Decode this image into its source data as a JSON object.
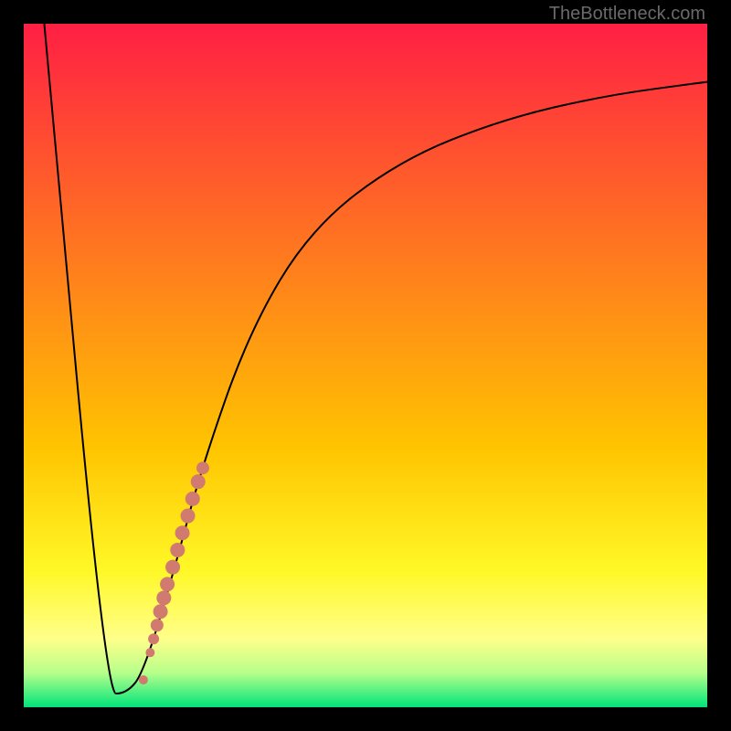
{
  "attribution": "TheBottleneck.com",
  "chart_data": {
    "type": "line",
    "title": "",
    "xlabel": "",
    "ylabel": "",
    "xlim": [
      0,
      100
    ],
    "ylim": [
      0,
      100
    ],
    "background_gradient": {
      "stops": [
        {
          "pos": 0.0,
          "color": "#ff1f44"
        },
        {
          "pos": 0.62,
          "color": "#ffc400"
        },
        {
          "pos": 0.8,
          "color": "#fff827"
        },
        {
          "pos": 0.9,
          "color": "#ffff8a"
        },
        {
          "pos": 0.95,
          "color": "#b5ff8a"
        },
        {
          "pos": 1.0,
          "color": "#00e47a"
        }
      ]
    },
    "series": [
      {
        "name": "bottleneck-curve",
        "type": "line",
        "color": "#000000",
        "points": [
          {
            "x": 3.0,
            "y": 100.0
          },
          {
            "x": 12.0,
            "y": 2.0
          },
          {
            "x": 15.0,
            "y": 2.0
          },
          {
            "x": 17.5,
            "y": 5.0
          },
          {
            "x": 22.0,
            "y": 20.0
          },
          {
            "x": 26.0,
            "y": 35.0
          },
          {
            "x": 33.0,
            "y": 55.0
          },
          {
            "x": 42.0,
            "y": 70.0
          },
          {
            "x": 55.0,
            "y": 80.0
          },
          {
            "x": 70.0,
            "y": 86.0
          },
          {
            "x": 85.0,
            "y": 89.5
          },
          {
            "x": 100.0,
            "y": 91.5
          }
        ]
      },
      {
        "name": "data-points-highlight",
        "type": "scatter",
        "color": "#d17a6f",
        "points": [
          {
            "x": 17.5,
            "y": 4.0,
            "r": 5
          },
          {
            "x": 18.5,
            "y": 8.0,
            "r": 5
          },
          {
            "x": 19.0,
            "y": 10.0,
            "r": 6
          },
          {
            "x": 19.5,
            "y": 12.0,
            "r": 7
          },
          {
            "x": 20.0,
            "y": 14.0,
            "r": 8
          },
          {
            "x": 20.5,
            "y": 16.0,
            "r": 8
          },
          {
            "x": 21.0,
            "y": 18.0,
            "r": 8
          },
          {
            "x": 21.8,
            "y": 20.5,
            "r": 8
          },
          {
            "x": 22.5,
            "y": 23.0,
            "r": 8
          },
          {
            "x": 23.2,
            "y": 25.5,
            "r": 8
          },
          {
            "x": 24.0,
            "y": 28.0,
            "r": 8
          },
          {
            "x": 24.7,
            "y": 30.5,
            "r": 8
          },
          {
            "x": 25.5,
            "y": 33.0,
            "r": 8
          },
          {
            "x": 26.2,
            "y": 35.0,
            "r": 7
          }
        ]
      }
    ]
  }
}
